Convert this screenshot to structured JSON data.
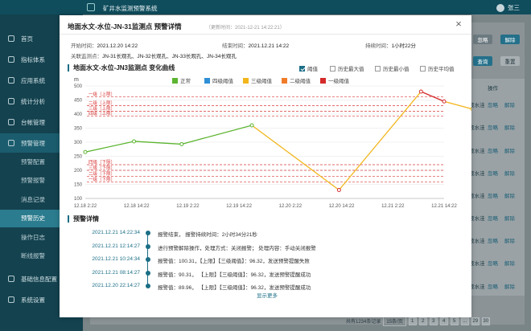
{
  "app": {
    "title": "矿井水监测预警系统",
    "user_name": "张三"
  },
  "sidebar": {
    "items": [
      {
        "label": "首页",
        "icon": "home-icon"
      },
      {
        "label": "指标体系",
        "icon": "index-icon",
        "chev": true
      },
      {
        "label": "应用系统",
        "icon": "app-icon",
        "chev": true
      },
      {
        "label": "统计分析",
        "icon": "chart-icon",
        "chev": true
      },
      {
        "label": "台帐管理",
        "icon": "ledger-icon",
        "chev": true
      },
      {
        "label": "预警管理",
        "icon": "warning-icon",
        "chev": true,
        "active": true
      }
    ],
    "subitems": [
      "预警配置",
      "预警报警",
      "消息记录",
      "预警历史",
      "操作日志",
      "断线报警"
    ],
    "active_sub": "预警历史",
    "items_after": [
      {
        "label": "基础信息配置",
        "icon": "config-icon",
        "chev": true
      },
      {
        "label": "系统设置",
        "icon": "settings-icon",
        "chev": true
      }
    ]
  },
  "background": {
    "buttons": [
      "忽略",
      "解除",
      "查询",
      "重置"
    ],
    "column_header": "操作",
    "row_actions": [
      "忽略",
      "解除"
    ],
    "row_texts": [
      "液水洼"
    ],
    "pager": {
      "summary": "共有1234条记录",
      "page_size": "15条/页",
      "pages": [
        "1",
        "2",
        "3",
        "4",
        "5",
        "...",
        "29",
        "30"
      ]
    }
  },
  "modal": {
    "title": "地面水文-水位-JN-31监测点 预警详情",
    "update_label": "（更新时间：2021-12-21 14:22:21）",
    "start_label": "开始时间：",
    "start_value": "2021.12.20 14:22",
    "end_label": "结束时间：",
    "end_value": "2021.12.21 14:22",
    "duration_label": "持续时间：",
    "duration_value": "1小时22分",
    "related_label": "关联监测点：",
    "related_value": "JN-31长观孔、JN-32长观孔、JN-33长观孔、JN-34长观孔",
    "chart_section_title": "地面水文-水位-JN3监测点 变化曲线",
    "chart_filters": [
      {
        "label": "阈值",
        "checked": true
      },
      {
        "label": "历史最大值",
        "checked": false
      },
      {
        "label": "历史最小值",
        "checked": false
      },
      {
        "label": "历史平均值",
        "checked": false
      }
    ],
    "detail_section_title": "预警详情",
    "show_more": "显示更多"
  },
  "chart_data": {
    "type": "line",
    "ylabel": "m",
    "ylim": [
      100,
      500
    ],
    "yticks": [
      100,
      150,
      200,
      250,
      300,
      350,
      400,
      450,
      500
    ],
    "x": [
      "12.18 2:22",
      "12.18 14:22",
      "12.19 2:22",
      "12.19 14:22",
      "12.20 2:22",
      "12.20 14:22",
      "12.21 2:22",
      "12.21 14:22"
    ],
    "points": [
      {
        "x": 0.0,
        "y": 265
      },
      {
        "x": 0.95,
        "y": 303
      },
      {
        "x": 1.88,
        "y": 293
      },
      {
        "x": 3.25,
        "y": 360
      },
      {
        "x": 4.95,
        "y": 130
      },
      {
        "x": 6.55,
        "y": 480
      },
      {
        "x": 7.0,
        "y": 445
      },
      {
        "x": 7.55,
        "y": 418
      }
    ],
    "segment_levels": [
      "正常",
      "正常",
      "正常",
      "三级阈值",
      "三级阈值",
      "一级阈值",
      "三级阈值"
    ],
    "series_legend": [
      {
        "name": "正常",
        "color": "#5cb531"
      },
      {
        "name": "四级阈值",
        "color": "#2f8fd6"
      },
      {
        "name": "三级阈值",
        "color": "#f2b61c"
      },
      {
        "name": "二级阈值",
        "color": "#f07c2a"
      },
      {
        "name": "一级阈值",
        "color": "#d42a2a"
      }
    ],
    "threshold_lines": [
      {
        "label": "一级（上限）",
        "y": 462
      },
      {
        "label": "二级（上限）",
        "y": 430
      },
      {
        "label": "三级（上限）",
        "y": 410
      },
      {
        "label": "四级（上限）",
        "y": 393
      },
      {
        "label": "四级（下限）",
        "y": 220
      },
      {
        "label": "三级（下限）",
        "y": 200
      },
      {
        "label": "二级（下限）",
        "y": 178
      },
      {
        "label": "一级（下限）",
        "y": 158
      }
    ]
  },
  "timeline": [
    {
      "time": "2021.12.21 14:22:34",
      "text": "报警结束，  报警持续时间：2小时34分21秒"
    },
    {
      "time": "2021.12.21 12:14:27",
      "text": "进行预警解除操作，处理方式：关闭报警；  处理内容：手动关闭报警"
    },
    {
      "time": "2021.12.21 10:24:34",
      "text": "报警值：100.31，【上限】【三级阈值】：96.32，发送预警提醒失败"
    },
    {
      "time": "2021.12.21 08:14:27",
      "text": "报警值：90.31，  【上限】【三级阈值】：96.32，发送预警提醒成功"
    },
    {
      "time": "2021.12.20 22:14:27",
      "text": "报警值：89.96，  【上限】【三级阈值】：96.32，发送预警提醒成功"
    }
  ],
  "colors": {
    "primary": "#1b6e86",
    "sidebar": "#14424f",
    "topbar": "#0f4c5c",
    "threshold": "#d93a3a"
  }
}
